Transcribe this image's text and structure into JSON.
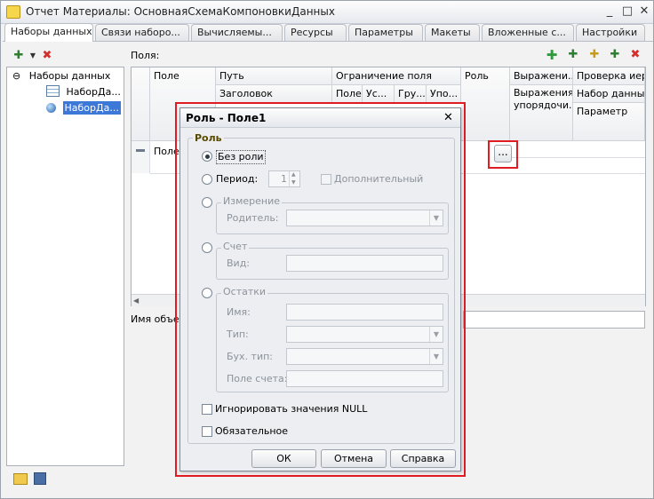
{
  "window": {
    "title": "Отчет Материалы: ОсновнаяСхемаКомпоновкиДанных",
    "tabs": [
      "Наборы данных",
      "Связи наборо...",
      "Вычисляемы...",
      "Ресурсы",
      "Параметры",
      "Макеты",
      "Вложенные с...",
      "Настройки"
    ]
  },
  "tree": {
    "root": "Наборы данных",
    "items": [
      "НаборДа...",
      "НаборДа..."
    ]
  },
  "fields": {
    "label": "Поля:",
    "columns": {
      "field": "Поле",
      "path": "Путь",
      "header": "Заголовок",
      "restriction": "Ограничение поля",
      "sub_field": "Поле",
      "sub_cond": "Ус...",
      "sub_group": "Гру...",
      "sub_order": "Упо...",
      "role": "Роль",
      "expressions": "Выражени...",
      "order_expr": "Выражения упорядочи...",
      "check": "Проверка иера",
      "dataset": "Набор данных",
      "param": "Параметр"
    },
    "row": {
      "field": "Поле1",
      "role_button": "..."
    },
    "object_name_label": "Имя объек"
  },
  "dialog": {
    "title": "Роль - Поле1",
    "group_title": "Роль",
    "no_role": "Без роли",
    "period": "Период:",
    "period_value": "1",
    "additional": "Дополнительный",
    "dimension": "Измерение",
    "parent": "Родитель:",
    "account": "Счет",
    "kind": "Вид:",
    "balances": "Остатки",
    "name": "Имя:",
    "type": "Тип:",
    "acc_type": "Бух. тип:",
    "acc_field": "Поле счета:",
    "ignore_null": "Игнорировать значения NULL",
    "required": "Обязательное",
    "ok": "ОК",
    "cancel": "Отмена",
    "help": "Справка"
  },
  "icons": {
    "close": "✕",
    "minimize": "_",
    "maximize": "□",
    "combo": "▼",
    "spin_up": "▲",
    "spin_down": "▼",
    "collapse": "⊖",
    "delete": "✖",
    "add": "✚"
  },
  "colors": {
    "highlight": "#e01b22",
    "selection": "#3c78d8"
  }
}
